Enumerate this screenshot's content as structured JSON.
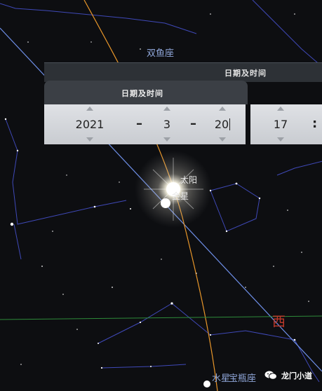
{
  "sky": {
    "constellation_pisces": "双鱼座",
    "constellation_aquarius": "宝瓶座",
    "sun_label": "太阳",
    "planet_label": "金星",
    "mercury_label": "水星",
    "west_label": "西"
  },
  "dialog": {
    "outer_title": "日期及时间",
    "tab_title": "日期及时间",
    "year": "2021",
    "month": "3",
    "day": "20",
    "hour": "17",
    "date_separator": "–",
    "time_separator": ":"
  },
  "watermark": {
    "text": "龙门小道",
    "icon": "wechat-icon"
  }
}
